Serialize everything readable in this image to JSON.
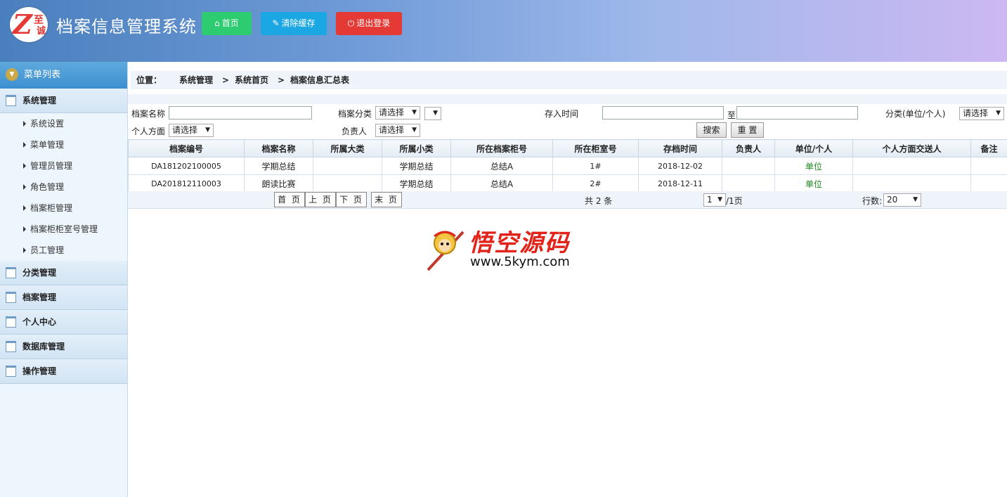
{
  "header": {
    "logo_text_1": "至",
    "logo_text_2": "诚",
    "logo_letter": "Z",
    "title": "档案信息管理系统",
    "buttons": {
      "home": "首页",
      "clear_cache": "清除缓存",
      "logout": "退出登录"
    },
    "button_colors": {
      "home": "#2ecc71",
      "clear_cache": "#1aa7e3",
      "logout": "#e53935"
    }
  },
  "sidebar": {
    "head": "菜单列表",
    "groups": [
      {
        "label": "系统管理",
        "items": [
          "系统设置",
          "菜单管理",
          "管理员管理",
          "角色管理",
          "档案柜管理",
          "档案柜柜室号管理",
          "员工管理"
        ]
      },
      {
        "label": "分类管理"
      },
      {
        "label": "档案管理"
      },
      {
        "label": "个人中心"
      },
      {
        "label": "数据库管理"
      },
      {
        "label": "操作管理"
      }
    ]
  },
  "breadcrumb": {
    "label": "位置：",
    "crumbs": [
      "系统管理",
      "系统首页",
      "档案信息汇总表"
    ],
    "separator": ">"
  },
  "search": {
    "name_label": "档案名称",
    "name_value": "",
    "category_label": "档案分类",
    "category_value": "请选择",
    "subcategory_value": "",
    "time_label": "存入时间",
    "time_from": "",
    "time_to_label": "至",
    "time_to": "",
    "unit_label": "分类(单位/个人)",
    "unit_value": "请选择",
    "personal_label": "个人方面",
    "personal_value": "请选择",
    "owner_label": "负责人",
    "owner_value": "请选择",
    "search_button": "搜索",
    "reset_button": "重 置"
  },
  "table": {
    "columns": [
      "档案编号",
      "档案名称",
      "所属大类",
      "所属小类",
      "所在档案柜号",
      "所在柜室号",
      "存档时间",
      "负责人",
      "单位/个人",
      "个人方面交送人",
      "备注"
    ],
    "rows": [
      [
        "DA181202100005",
        "学期总结",
        "",
        "学期总结",
        "总结A",
        "1#",
        "2018-12-02",
        "",
        "单位",
        "",
        ""
      ],
      [
        "DA201812110003",
        "朗读比赛",
        "",
        "学期总结",
        "总结A",
        "2#",
        "2018-12-11",
        "",
        "单位",
        "",
        ""
      ]
    ]
  },
  "pager": {
    "first": "首 页",
    "prev": "上 页",
    "next": "下 页",
    "last": "末 页",
    "total": "共 2 条",
    "page_value": "1",
    "page_suffix": "/1页",
    "rows_label": "行数:",
    "rows_value": "20"
  },
  "watermark": {
    "text": "悟空源码",
    "url": "www.5kym.com"
  }
}
